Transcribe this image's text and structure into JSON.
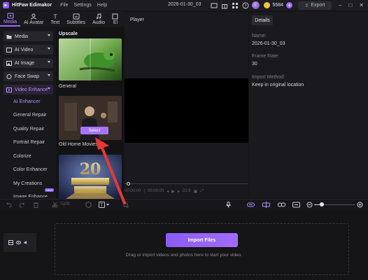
{
  "app": {
    "name": "HitPaw Edimakor",
    "menu": [
      "File",
      "Settings",
      "Help"
    ],
    "project_title": "2026-01-30_03",
    "credits": "5584",
    "export_label": "Export"
  },
  "tabs": [
    {
      "label": "Media",
      "icon": "media-icon",
      "active": true
    },
    {
      "label": "AI Avatar",
      "icon": "ai-avatar-icon"
    },
    {
      "label": "Text",
      "icon": "text-icon"
    },
    {
      "label": "Subtitles",
      "icon": "subtitles-icon"
    },
    {
      "label": "Audio",
      "icon": "audio-icon"
    },
    {
      "label": "El",
      "icon": "elements-icon"
    }
  ],
  "nav": {
    "items": [
      {
        "label": "Media",
        "icon": "folder-icon"
      },
      {
        "label": "AI Video",
        "icon": "ai-video-icon"
      },
      {
        "label": "AI Image",
        "icon": "ai-image-icon"
      },
      {
        "label": "Face Swap",
        "icon": "face-swap-icon"
      },
      {
        "label": "Video Enhance",
        "icon": "video-enhance-icon",
        "open": true
      }
    ],
    "subitems": [
      "AI Enhancer",
      "General Repair",
      "Quality Repair",
      "Portrait Repair",
      "Colorize",
      "Color Enhancer",
      "My Creations"
    ],
    "cut_item": "Image Enhance",
    "badge": "NEW"
  },
  "media": {
    "section_title": "Upscale",
    "cards": [
      {
        "label": "General"
      },
      {
        "label": "Old Home Movies"
      },
      {
        "label": ""
      }
    ],
    "select_label": "Select"
  },
  "player": {
    "title": "Player",
    "time_current": "00:00:00",
    "time_total": "00:00:00",
    "ratio": "21:9"
  },
  "details": {
    "tab_label": "Details",
    "fields": [
      {
        "label": "Name:",
        "value": "2026-01-30_03"
      },
      {
        "label": "Frame Rate:",
        "value": "30"
      },
      {
        "label": "Import Method:",
        "value": "Keep in original location"
      }
    ]
  },
  "timeline": {
    "split_label": "Split",
    "import_label": "Import Files",
    "drop_hint": "Drag or import videos and photos here to start your video."
  },
  "colors": {
    "accent": "#9B6BFF",
    "import_button": "#8B5CF6",
    "annotation_arrow": "#E53935"
  }
}
